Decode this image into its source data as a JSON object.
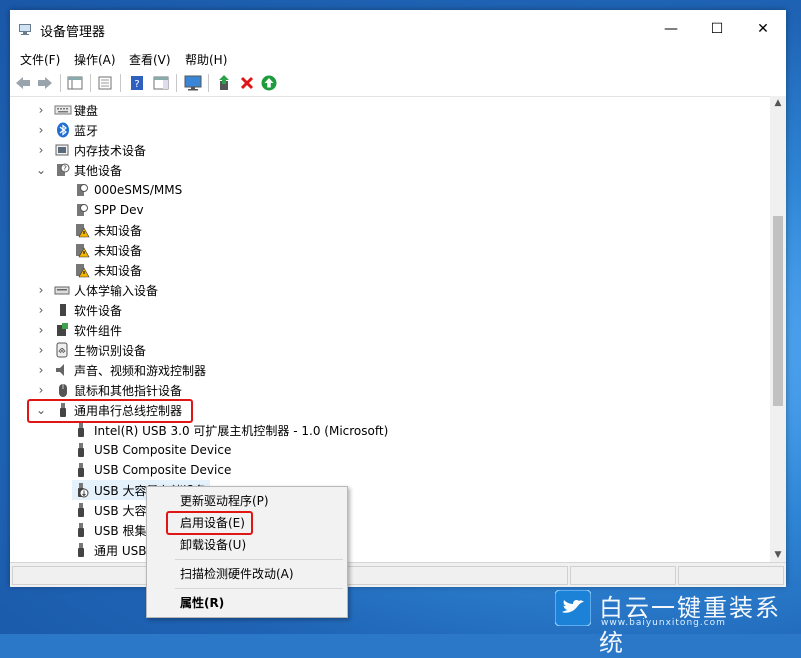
{
  "window": {
    "title": "设备管理器",
    "minimize_glyph": "—",
    "maximize_glyph": "☐",
    "close_glyph": "✕"
  },
  "menu": [
    "文件(F)",
    "操作(A)",
    "查看(V)",
    "帮助(H)"
  ],
  "toolbar_icons": [
    "back-icon",
    "forward-icon",
    "properties-view-icon",
    "show-hidden-icon",
    "help-icon",
    "action-pane-icon",
    "monitor-scan-icon",
    "update-driver-icon",
    "uninstall-icon",
    "enable-device-icon"
  ],
  "tree": {
    "categories": [
      {
        "label": "键盘",
        "icon": "keyboard-icon",
        "expanded": false
      },
      {
        "label": "蓝牙",
        "icon": "bluetooth-icon",
        "expanded": false
      },
      {
        "label": "内存技术设备",
        "icon": "memory-icon",
        "expanded": false
      },
      {
        "label": "其他设备",
        "icon": "other-devices-icon",
        "expanded": true
      },
      {
        "label": "人体学输入设备",
        "icon": "hid-icon",
        "expanded": false
      },
      {
        "label": "软件设备",
        "icon": "software-device-icon",
        "expanded": false
      },
      {
        "label": "软件组件",
        "icon": "software-component-icon",
        "expanded": false
      },
      {
        "label": "生物识别设备",
        "icon": "biometric-icon",
        "expanded": false
      },
      {
        "label": "声音、视频和游戏控制器",
        "icon": "sound-icon",
        "expanded": false
      },
      {
        "label": "鼠标和其他指针设备",
        "icon": "mouse-icon",
        "expanded": false
      },
      {
        "label": "通用串行总线控制器",
        "icon": "usb-icon",
        "expanded": true
      }
    ],
    "other_devices": [
      "000eSMS/MMS",
      "SPP Dev",
      "未知设备",
      "未知设备",
      "未知设备"
    ],
    "usb_devices": [
      "Intel(R) USB 3.0 可扩展主机控制器 - 1.0 (Microsoft)",
      "USB Composite Device",
      "USB Composite Device",
      "USB 大容量存储设备",
      "USB 大容",
      "USB 根集",
      "通用 USB"
    ]
  },
  "context_menu": {
    "items": [
      "更新驱动程序(P)",
      "启用设备(E)",
      "卸载设备(U)",
      "扫描检测硬件改动(A)",
      "属性(R)"
    ]
  },
  "watermark": {
    "text": "白云一键重装系统",
    "url": "www.baiyunxitong.com"
  },
  "colors": {
    "highlight_red": "#e01515",
    "desktop_blue": "#2a78c7",
    "selection": "#e5f1fb"
  }
}
